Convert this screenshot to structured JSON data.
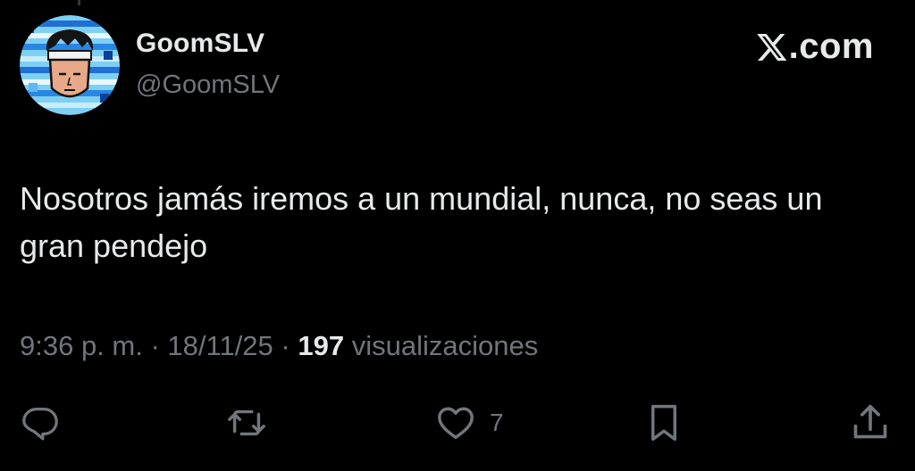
{
  "author": {
    "display_name": "GoomSLV",
    "handle": "@GoomSLV"
  },
  "brand": {
    "text": ".com",
    "icon": "x-logo-icon"
  },
  "tweet": {
    "text": "Nosotros jamás iremos a un mundial, nunca, no seas un gran pendejo"
  },
  "meta": {
    "time": "9:36 p. m.",
    "sep1": " · ",
    "date": "18/11/25",
    "sep2": " · ",
    "views_count": "197",
    "views_label": " visualizaciones"
  },
  "actions": {
    "reply": {
      "icon": "reply-icon"
    },
    "repost": {
      "icon": "repost-icon"
    },
    "like": {
      "icon": "heart-icon",
      "count": "7"
    },
    "bookmark": {
      "icon": "bookmark-icon"
    },
    "share": {
      "icon": "share-icon"
    }
  },
  "colors": {
    "background": "#000000",
    "primary_text": "#e7e9ea",
    "secondary_text": "#71767b"
  }
}
